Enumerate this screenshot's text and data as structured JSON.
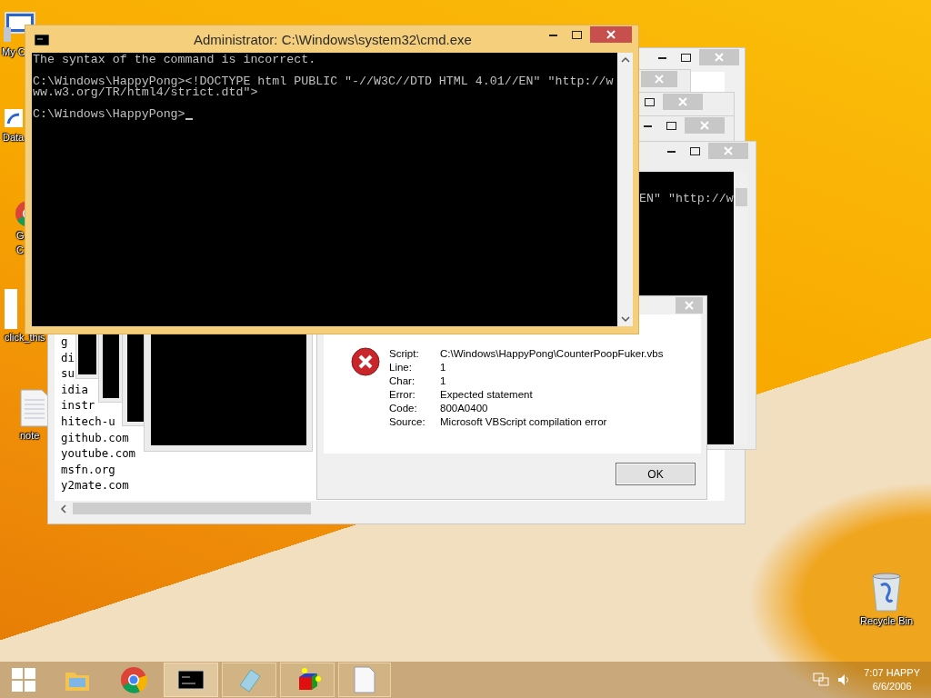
{
  "desktop_icons": [
    {
      "kind": "computer",
      "lines": [
        "My C"
      ]
    },
    {
      "kind": "shortcut",
      "lines": [
        "Data"
      ]
    },
    {
      "kind": "chrome",
      "lines": [
        "G",
        "C"
      ]
    },
    {
      "kind": "blank",
      "lines": [
        "click_this"
      ]
    },
    {
      "kind": "textfile",
      "lines": [
        "note"
      ]
    },
    {
      "kind": "recycle",
      "lines": [
        "Recycle Bin"
      ]
    }
  ],
  "notepad": {
    "lines": [
      "g",
      "di",
      "su",
      "idia",
      "instr",
      "hitech-u",
      "github.com",
      "youtube.com",
      "msfn.org",
      "y2mate.com"
    ]
  },
  "back_console": {
    "line": "EN\" \"http://w"
  },
  "dialog": {
    "rows": [
      {
        "label": "Script:",
        "value": "C:\\Windows\\HappyPong\\CounterPoopFuker.vbs"
      },
      {
        "label": "Line:",
        "value": "1"
      },
      {
        "label": "Char:",
        "value": "1"
      },
      {
        "label": "Error:",
        "value": "Expected statement"
      },
      {
        "label": "Code:",
        "value": "800A0400"
      },
      {
        "label": "Source:",
        "value": "Microsoft VBScript compilation error"
      }
    ],
    "button": "OK"
  },
  "console": {
    "title": "Administrator: C:\\Windows\\system32\\cmd.exe",
    "blocks": [
      [
        "The syntax of the command is incorrect."
      ],
      [
        "C:\\Windows\\HappyPong><!DOCTYPE html PUBLIC \"-//W3C//DTD HTML 4.01//EN\" \"http://w",
        "ww.w3.org/TR/html4/strict.dtd\">"
      ],
      [
        "C:\\Windows\\HappyPong>"
      ]
    ]
  },
  "taskbar": {
    "items": [
      {
        "kind": "explorer",
        "running": false,
        "selected": false
      },
      {
        "kind": "chrome",
        "running": false,
        "selected": false
      },
      {
        "kind": "console",
        "running": true,
        "selected": true
      },
      {
        "kind": "notepad",
        "running": true,
        "selected": false
      },
      {
        "kind": "cube",
        "running": true,
        "selected": false
      },
      {
        "kind": "document",
        "running": true,
        "selected": false
      }
    ],
    "clock": {
      "time": "7:07 HAPPY",
      "date": "6/6/2006"
    }
  }
}
